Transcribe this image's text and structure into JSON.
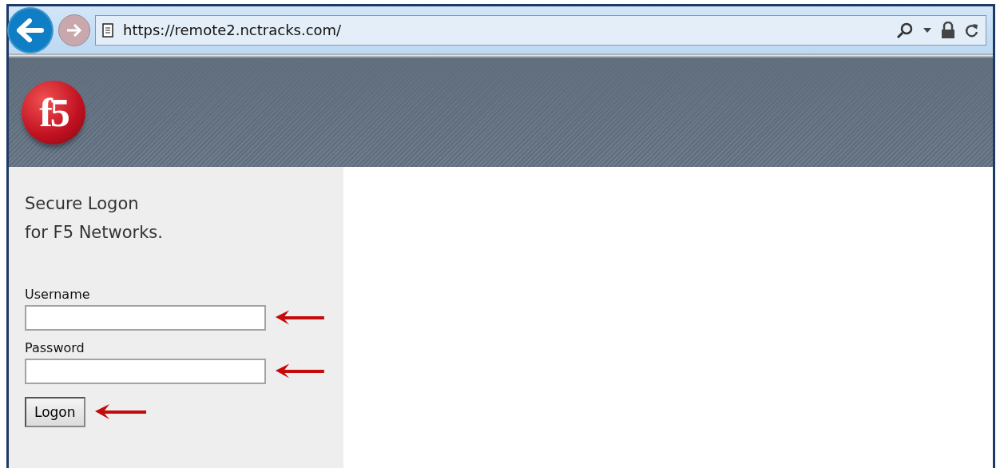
{
  "browser": {
    "address": "https://remote2.nctracks.com/"
  },
  "header": {
    "logo": "f5"
  },
  "login": {
    "title": "Secure Logon",
    "subtitle": "for F5 Networks.",
    "fields": [
      {
        "label": "Username"
      },
      {
        "label": "Password"
      }
    ],
    "button": "Logon"
  }
}
